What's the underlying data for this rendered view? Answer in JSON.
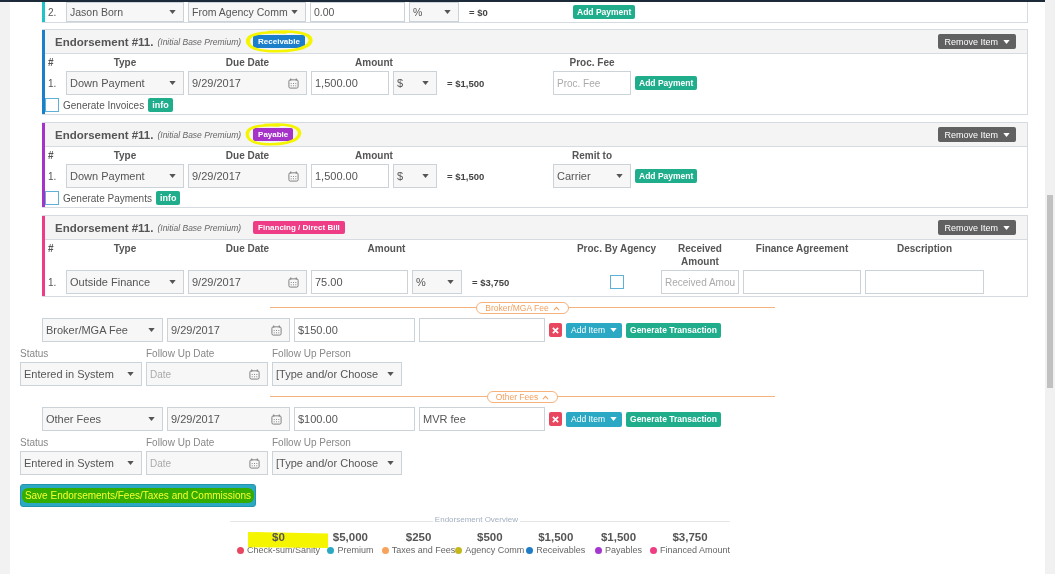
{
  "cards": [
    {
      "kind": "commission",
      "color": "#1fc3c9",
      "rows": [
        {
          "number": "2.",
          "fields": [
            {
              "kind": "select",
              "value": "Jason Born"
            },
            {
              "kind": "select",
              "value": "From Agency Comm"
            },
            {
              "kind": "text",
              "value": "0.00"
            },
            {
              "kind": "select",
              "value": "%"
            }
          ],
          "total": "= $0",
          "button": "Add Payment"
        }
      ]
    },
    {
      "kind": "receivable",
      "title": "Endorsement #11.",
      "subtitle": "(Initial Base Premium)",
      "badge": "Receivable",
      "color": "#1b7fcc",
      "highlighted": true,
      "action": "Remove Item",
      "columns": [
        "#",
        "Type",
        "Due Date",
        "Amount",
        "Proc. Fee"
      ],
      "rows": [
        {
          "number": "1.",
          "fields": [
            {
              "kind": "select",
              "value": "Down Payment"
            },
            {
              "kind": "date",
              "value": "9/29/2017"
            },
            {
              "kind": "text",
              "value": "1,500.00"
            },
            {
              "kind": "select",
              "value": "$"
            }
          ],
          "total": "= $1,500",
          "extras": [
            {
              "kind": "text",
              "placeholder": "Proc. Fee"
            }
          ],
          "button": "Add Payment"
        }
      ],
      "generate": {
        "checked": false,
        "label": "Generate Invoices",
        "info": "info"
      }
    },
    {
      "kind": "payable",
      "title": "Endorsement #11.",
      "subtitle": "(Initial Base Premium)",
      "badge": "Payable",
      "color": "#a533c9",
      "highlighted": true,
      "action": "Remove Item",
      "columns": [
        "#",
        "Type",
        "Due Date",
        "Amount",
        "Remit to"
      ],
      "rows": [
        {
          "number": "1.",
          "fields": [
            {
              "kind": "select",
              "value": "Down Payment"
            },
            {
              "kind": "date",
              "value": "9/29/2017"
            },
            {
              "kind": "text",
              "value": "1,500.00"
            },
            {
              "kind": "select",
              "value": "$"
            }
          ],
          "total": "= $1,500",
          "extras": [
            {
              "kind": "select",
              "value": "Carrier"
            }
          ],
          "button": "Add Payment"
        }
      ],
      "generate": {
        "checked": false,
        "label": "Generate Payments",
        "info": "info"
      }
    },
    {
      "kind": "financing",
      "title": "Endorsement #11.",
      "subtitle": "(Initial Base Premium)",
      "badge": "Financing / Direct Bill",
      "color": "#ee3c86",
      "highlighted": false,
      "action": "Remove Item",
      "columns": [
        "#",
        "Type",
        "Due Date",
        "Amount",
        "Proc. By Agency",
        "Received Amount",
        "Finance Agreement",
        "Description"
      ],
      "rows": [
        {
          "number": "1.",
          "fields": [
            {
              "kind": "select",
              "value": "Outside Finance"
            },
            {
              "kind": "date",
              "value": "9/29/2017"
            },
            {
              "kind": "text",
              "value": "75.00"
            },
            {
              "kind": "select",
              "value": "%"
            }
          ],
          "total": "= $3,750",
          "extras": [
            {
              "kind": "checkbox",
              "checked": false
            },
            {
              "kind": "text",
              "placeholder": "Received Amou"
            },
            {
              "kind": "text"
            },
            {
              "kind": "text"
            }
          ]
        }
      ]
    }
  ],
  "fees": [
    {
      "title": "Broker/MGA Fee",
      "expanded": true,
      "fields": [
        {
          "kind": "select",
          "value": "Broker/MGA Fee"
        },
        {
          "kind": "date",
          "value": "9/29/2017"
        },
        {
          "kind": "text",
          "value": "$150.00"
        },
        {
          "kind": "text"
        }
      ],
      "add": "Add Item",
      "generate": "Generate Transaction",
      "status_labels": [
        "Status",
        "Follow Up Date",
        "Follow Up Person"
      ],
      "status_fields": [
        {
          "kind": "select",
          "value": "Entered in System"
        },
        {
          "kind": "date",
          "placeholder": "Date"
        },
        {
          "kind": "select",
          "value": "[Type and/or Choose"
        }
      ]
    },
    {
      "title": "Other Fees",
      "expanded": true,
      "fields": [
        {
          "kind": "select",
          "value": "Other Fees"
        },
        {
          "kind": "date",
          "value": "9/29/2017"
        },
        {
          "kind": "text",
          "value": "$100.00"
        },
        {
          "kind": "text",
          "value": "MVR fee"
        }
      ],
      "add": "Add Item",
      "generate": "Generate Transaction",
      "status_labels": [
        "Status",
        "Follow Up Date",
        "Follow Up Person"
      ],
      "status_fields": [
        {
          "kind": "select",
          "value": "Entered in System"
        },
        {
          "kind": "date",
          "placeholder": "Date"
        },
        {
          "kind": "select",
          "value": "[Type and/or Choose"
        }
      ]
    }
  ],
  "save": {
    "label": "Save Endorsements/Fees/Taxes and Commissions",
    "highlighted": true
  },
  "overview": {
    "title": "Endorsement Overview",
    "items": [
      {
        "value": "$0",
        "label": "Check-sum/Sanity",
        "color": "#e8475f",
        "highlighted": true
      },
      {
        "value": "$5,000",
        "label": "Premium",
        "color": "#2aa8c4",
        "highlighted": false
      },
      {
        "value": "$250",
        "label": "Taxes and Fees",
        "color": "#f7a35c",
        "highlighted": false
      },
      {
        "value": "$500",
        "label": "Agency Comm",
        "color": "#c4b81c",
        "highlighted": false
      },
      {
        "value": "$1,500",
        "label": "Receivables",
        "color": "#1f7cc7",
        "highlighted": false
      },
      {
        "value": "$1,500",
        "label": "Payables",
        "color": "#a537d0",
        "highlighted": false
      },
      {
        "value": "$3,750",
        "label": "Financed Amount",
        "color": "#ef3d84",
        "highlighted": false
      }
    ]
  }
}
